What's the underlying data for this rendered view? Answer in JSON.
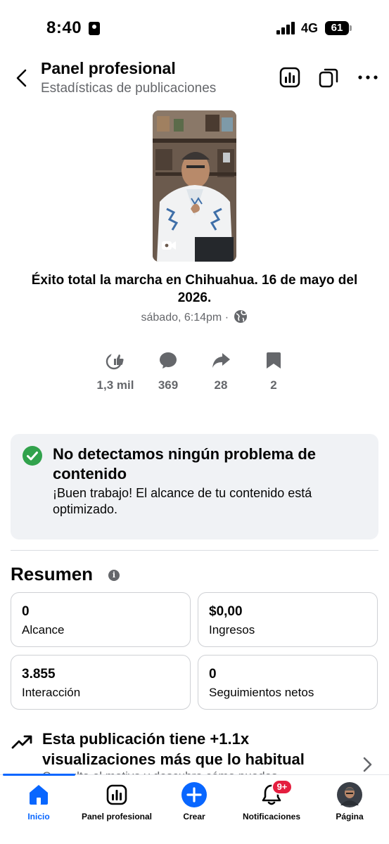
{
  "status_bar": {
    "time": "8:40",
    "network": "4G",
    "battery": "61"
  },
  "header": {
    "title": "Panel profesional",
    "subtitle": "Estadísticas de publicaciones"
  },
  "post": {
    "title": "Éxito total la marcha en Chihuahua. 16 de mayo del 2026.",
    "meta": "sábado, 6:14pm ·",
    "stats": {
      "reactions": "1,3 mil",
      "comments": "369",
      "shares": "28",
      "saves": "2"
    }
  },
  "content_status": {
    "title": "No detectamos ningún problema de contenido",
    "description": "¡Buen trabajo! El alcance de tu contenido está optimizado."
  },
  "summary": {
    "heading": "Resumen",
    "info_icon": "i",
    "metrics": [
      {
        "value": "0",
        "label": "Alcance"
      },
      {
        "value": "$0,00",
        "label": "Ingresos"
      },
      {
        "value": "3.855",
        "label": "Interacción"
      },
      {
        "value": "0",
        "label": "Seguimientos netos"
      }
    ]
  },
  "insight": {
    "text": "Esta publicación tiene +1.1x visualizaciones más que lo habitual",
    "subtext": "Consulta el motivo y descubre cómo puedes"
  },
  "tabbar": {
    "tabs": [
      {
        "label": "Inicio"
      },
      {
        "label": "Panel profesional"
      },
      {
        "label": "Crear"
      },
      {
        "label": "Notificaciones",
        "badge": "9+"
      },
      {
        "label": "Página"
      }
    ]
  },
  "colors": {
    "accent": "#0866ff",
    "success": "#31a24c",
    "badge": "#e41e3f",
    "secondary_text": "#65676b"
  }
}
